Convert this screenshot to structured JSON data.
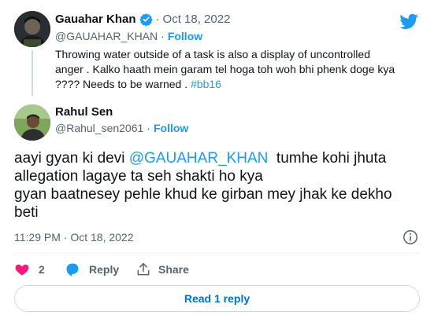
{
  "parent_tweet": {
    "author_name": "Gauahar Khan",
    "verified": true,
    "separator": "·",
    "date": "Oct 18, 2022",
    "handle": "@GAUAHAR_KHAN",
    "follow_label": "Follow",
    "text_line1": "Throwing water outside of a task is also a display of uncontrolled",
    "text_line2": "anger . Kalko haath mein garam tel hoga toh woh bhi phenk doge kya",
    "text_line3_plain": "???? Needs to be warned . ",
    "hashtag": "#bb16"
  },
  "reply_tweet": {
    "author_name": "Rahul Sen",
    "handle": "@Rahul_sen2061",
    "follow_label": "Follow",
    "text_part1": "aayi gyan ki devi ",
    "mention": "@GAUAHAR_KHAN",
    "text_part2": "  tumhe kohi jhuta",
    "text_line2": "allegation lagaye ta seh shakti ho kya",
    "text_line3": "gyan baatnesey pehle khud ke girban mey jhak ke dekho",
    "text_line4": "beti",
    "timestamp": "11:29 PM · Oct 18, 2022",
    "likes_count": "2",
    "reply_label": "Reply",
    "share_label": "Share",
    "read_replies_label": "Read 1 reply"
  },
  "colors": {
    "accent": "#1d9bf0",
    "like": "#f91880",
    "muted": "#536471"
  },
  "icons": [
    "twitter-bird-icon",
    "verified-badge-icon",
    "info-icon",
    "heart-icon",
    "reply-bubble-icon",
    "share-icon"
  ]
}
